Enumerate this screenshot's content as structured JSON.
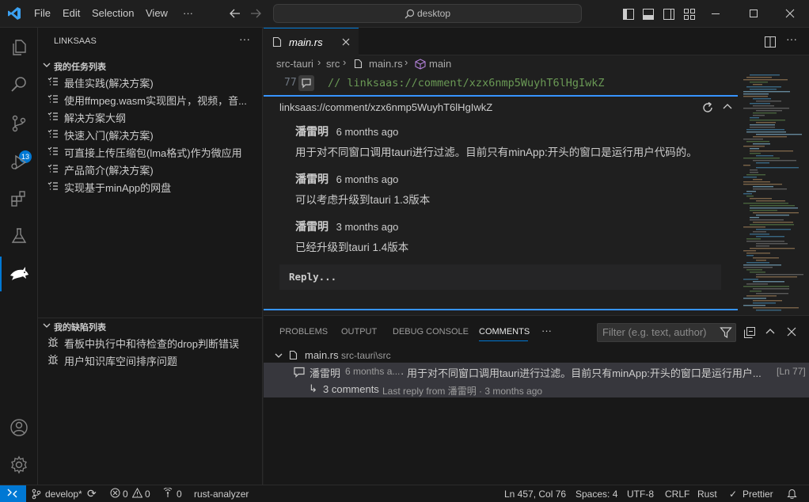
{
  "menu": [
    "File",
    "Edit",
    "Selection",
    "View",
    "···"
  ],
  "search": {
    "text": "desktop"
  },
  "activity": {
    "scm_badge": "13"
  },
  "sidebar": {
    "title": "LINKSAAS",
    "section1": {
      "title": "我的任务列表",
      "items": [
        "最佳实践(解决方案)",
        "使用ffmpeg.wasm实现图片，视频，音...",
        "解决方案大纲",
        "快速入门(解决方案)",
        "可直接上传压缩包(lma格式)作为微应用",
        "产品简介(解决方案)",
        "实现基于minApp的网盘"
      ]
    },
    "section2": {
      "title": "我的缺陷列表",
      "items": [
        "看板中执行中和待检查的drop判断错误",
        "用户知识库空间排序问题"
      ]
    }
  },
  "editor": {
    "tab_label": "main.rs",
    "breadcrumb": [
      "src-tauri",
      "src",
      "main.rs",
      "main"
    ],
    "line_number": "77",
    "line_code": "// linksaas://comment/xzx6nmp5WuyhT6lHgIwkZ",
    "thread": {
      "title": "linksaas://comment/xzx6nmp5WuyhT6lHgIwkZ",
      "comments": [
        {
          "author": "潘雷明",
          "time": "6 months ago",
          "body": "用于对不同窗口调用tauri进行过滤。目前只有minApp:开头的窗口是运行用户代码的。"
        },
        {
          "author": "潘雷明",
          "time": "6 months ago",
          "body": "可以考虑升级到tauri 1.3版本"
        },
        {
          "author": "潘雷明",
          "time": "3 months ago",
          "body": "已经升级到tauri 1.4版本"
        }
      ],
      "reply_placeholder": "Reply..."
    }
  },
  "panel": {
    "tabs": [
      "PROBLEMS",
      "OUTPUT",
      "DEBUG CONSOLE",
      "COMMENTS"
    ],
    "more": "···",
    "filter_placeholder": "Filter (e.g. text, author)",
    "file": {
      "name": "main.rs",
      "path": "src-tauri\\src"
    },
    "entry": {
      "author": "潘雷明",
      "time": "6 months a...",
      "text": "· 用于对不同窗口调用tauri进行过滤。目前只有minApp:开头的窗口是运行用户...",
      "line": "[Ln 77]",
      "replies": "3 comments",
      "last_reply": "Last reply from 潘雷明 · 3 months ago"
    }
  },
  "status": {
    "branch": "develop*",
    "errors": "0",
    "warnings": "0",
    "ports": "0",
    "analyzer": "rust-analyzer",
    "position": "Ln 457, Col 76",
    "spaces": "Spaces: 4",
    "encoding": "UTF-8",
    "eol": "CRLF",
    "language": "Rust",
    "prettier": "Prettier"
  },
  "colors": {
    "accent": "#0078d4",
    "thread_border": "#3794ff",
    "comment_green": "#6a9955"
  }
}
